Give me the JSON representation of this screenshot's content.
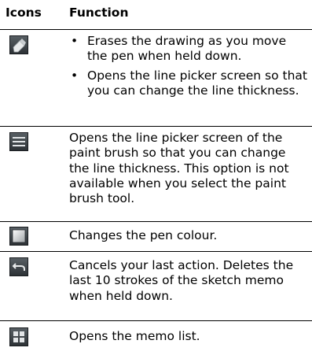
{
  "header": {
    "col_icons": "Icons",
    "col_function": "Function"
  },
  "rows": [
    {
      "icon": "eraser-icon",
      "bullets": [
        "Erases the drawing as you move the pen when held down.",
        "Opens the line picker screen so that you can change the line thickness."
      ]
    },
    {
      "icon": "line-thickness-icon",
      "text": "Opens the line picker screen of the paint brush so that you can change the line thickness. This option is not available when you select the paint brush tool."
    },
    {
      "icon": "pen-colour-icon",
      "text": "Changes the pen colour."
    },
    {
      "icon": "undo-icon",
      "text": "Cancels your last action. Deletes the last 10 strokes of the sketch memo when held down."
    },
    {
      "icon": "memo-list-icon",
      "text": "Opens the memo list."
    }
  ]
}
